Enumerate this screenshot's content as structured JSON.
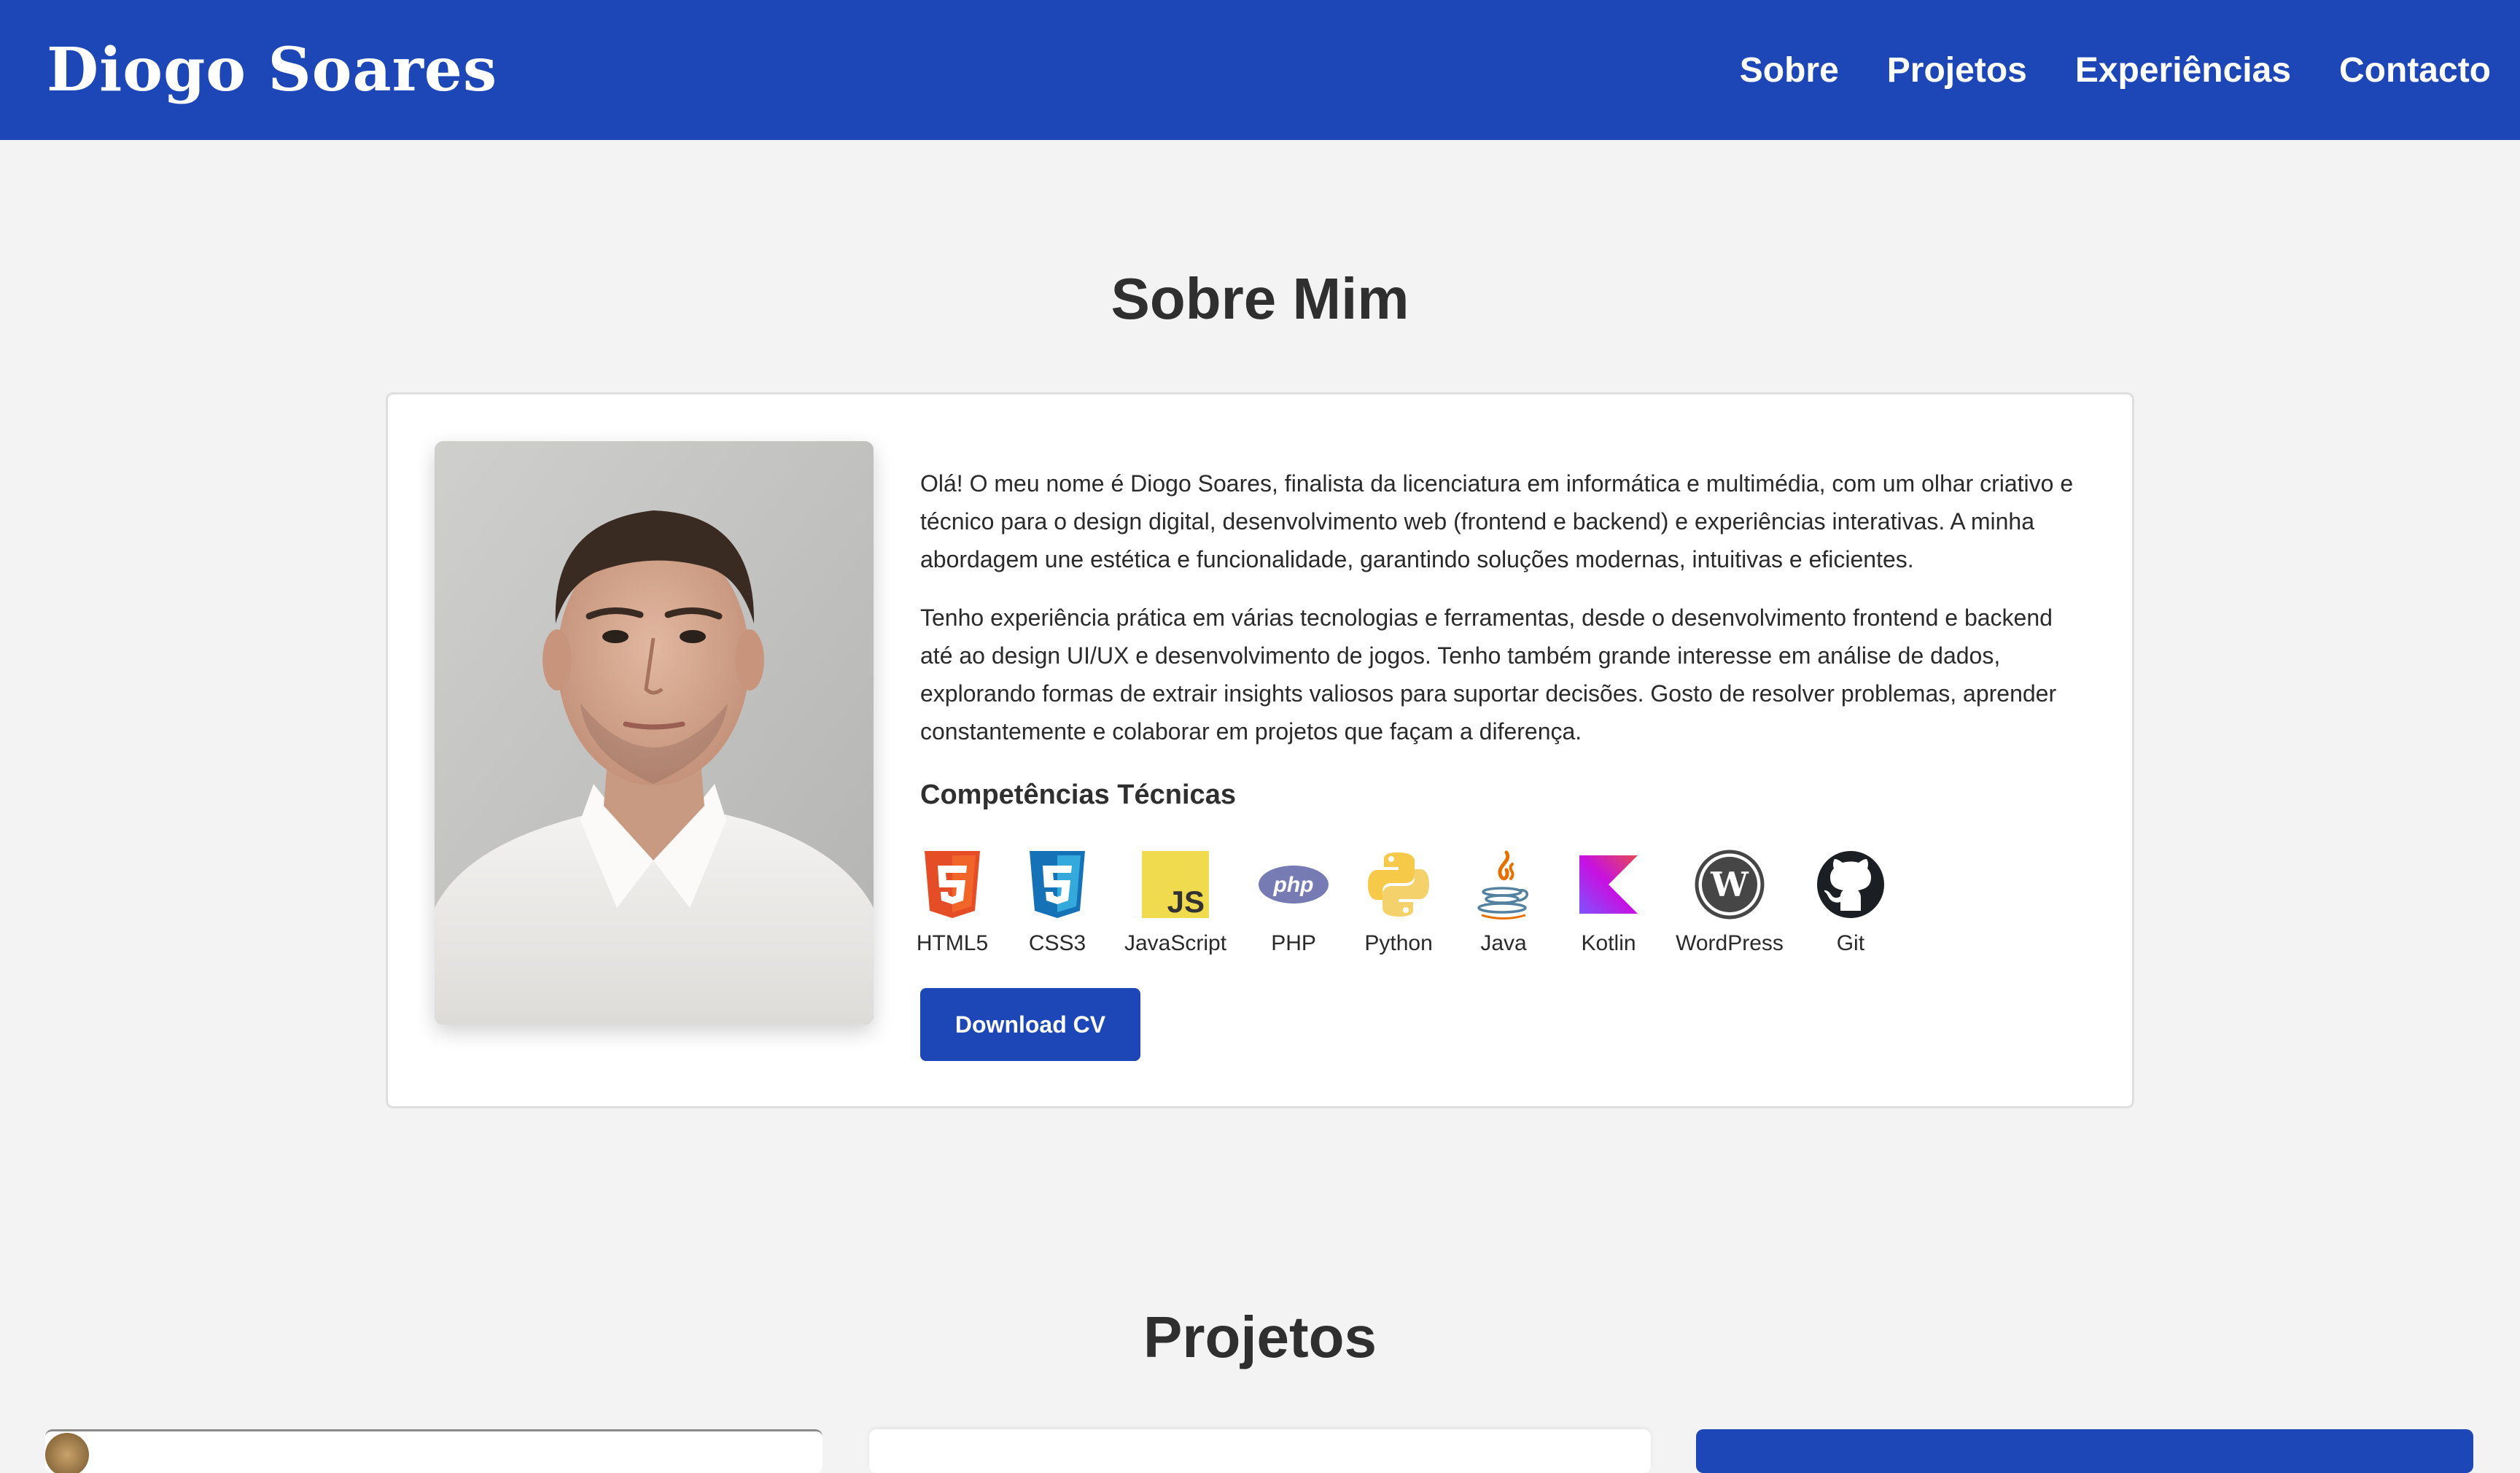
{
  "header": {
    "brand": "Diogo Soares",
    "nav": [
      "Sobre",
      "Projetos",
      "Experiências",
      "Contacto"
    ]
  },
  "about": {
    "title": "Sobre Mim",
    "paragraphs": [
      "Olá! O meu nome é Diogo Soares, finalista da licenciatura em informática e multimédia, com um olhar criativo e técnico para o design digital, desenvolvimento web (frontend e backend) e experiências interativas. A minha abordagem une estética e funcionalidade, garantindo soluções modernas, intuitivas e eficientes.",
      "Tenho experiência prática em várias tecnologias e ferramentas, desde o desenvolvimento frontend e backend até ao design UI/UX e desenvolvimento de jogos. Tenho também grande interesse em análise de dados, explorando formas de extrair insights valiosos para suportar decisões. Gosto de resolver problemas, aprender constantemente e colaborar em projetos que façam a diferença."
    ],
    "skills_title": "Competências Técnicas",
    "skills": [
      {
        "label": "HTML5",
        "icon": "html5-icon"
      },
      {
        "label": "CSS3",
        "icon": "css3-icon"
      },
      {
        "label": "JavaScript",
        "icon": "javascript-icon"
      },
      {
        "label": "PHP",
        "icon": "php-icon"
      },
      {
        "label": "Python",
        "icon": "python-icon"
      },
      {
        "label": "Java",
        "icon": "java-icon"
      },
      {
        "label": "Kotlin",
        "icon": "kotlin-icon"
      },
      {
        "label": "WordPress",
        "icon": "wordpress-icon"
      },
      {
        "label": "Git",
        "icon": "github-icon"
      }
    ],
    "download_label": "Download CV"
  },
  "projects": {
    "title": "Projetos"
  },
  "colors": {
    "primary": "#1d47b7",
    "background": "#f3f3f3",
    "card": "#ffffff",
    "text": "#333333"
  }
}
